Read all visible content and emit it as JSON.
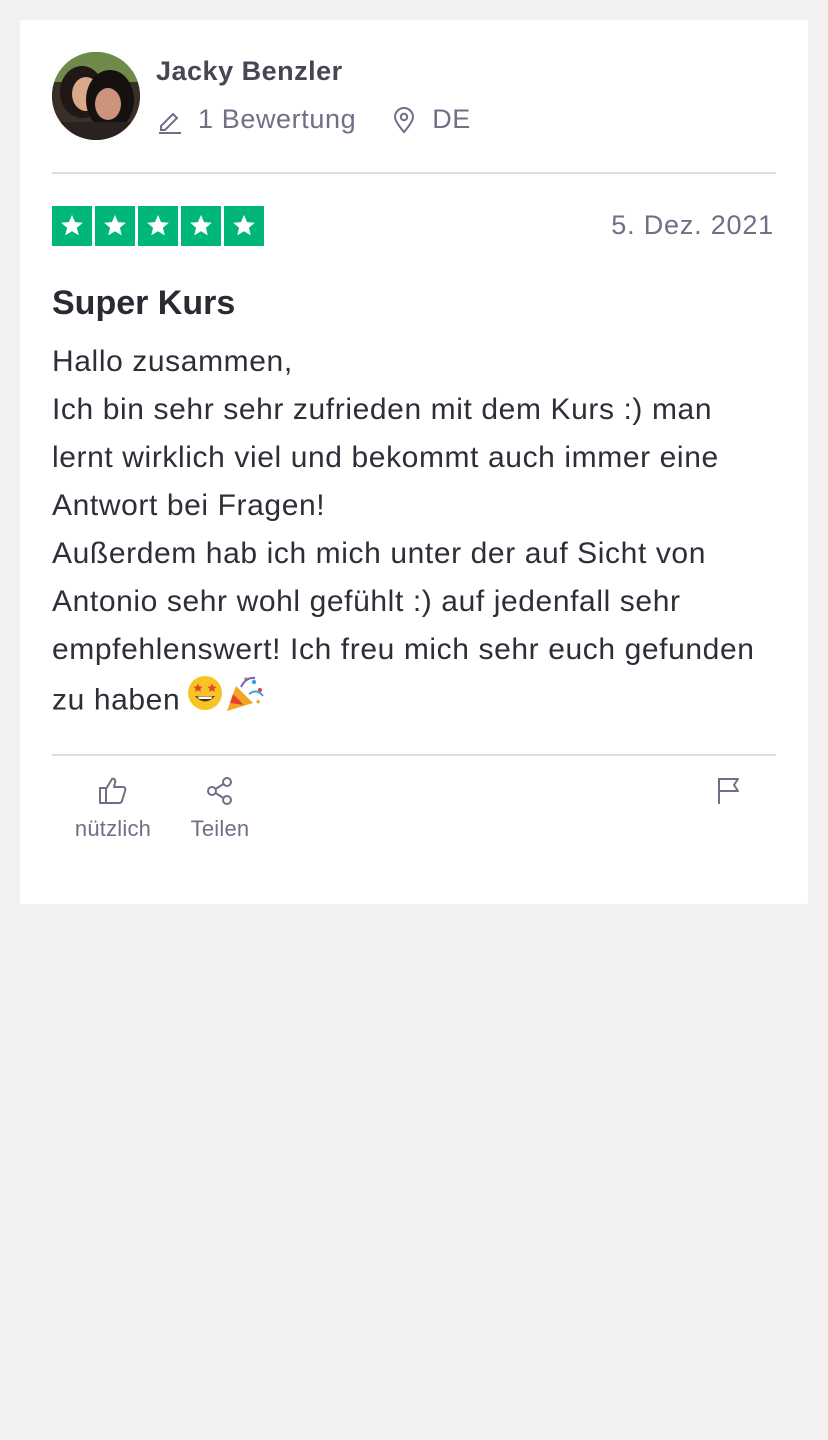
{
  "review": {
    "author": {
      "name": "Jacky Benzler",
      "review_count": "1 Bewertung",
      "country": "DE",
      "review_count_icon": "pencil-icon",
      "country_icon": "location-pin-icon"
    },
    "rating": {
      "stars": 5,
      "max": 5,
      "color": "#00b67a"
    },
    "date": "5. Dez. 2021",
    "title": "Super Kurs",
    "body_lines": [
      "Hallo zusammen,",
      "Ich bin sehr sehr zufrieden mit dem Kurs :) man lernt wirklich viel und bekommt auch immer eine Antwort bei Fragen!",
      "Außerdem hab ich mich unter der auf Sicht von Antonio sehr wohl gefühlt :) auf jedenfall sehr empfehlenswert! Ich freu mich sehr euch gefunden zu haben"
    ],
    "emojis": [
      "star-struck-emoji",
      "party-popper-emoji"
    ]
  },
  "actions": {
    "useful_label": "nützlich",
    "share_label": "Teilen",
    "useful_icon": "thumbs-up-icon",
    "share_icon": "share-icon",
    "flag_icon": "flag-icon"
  }
}
